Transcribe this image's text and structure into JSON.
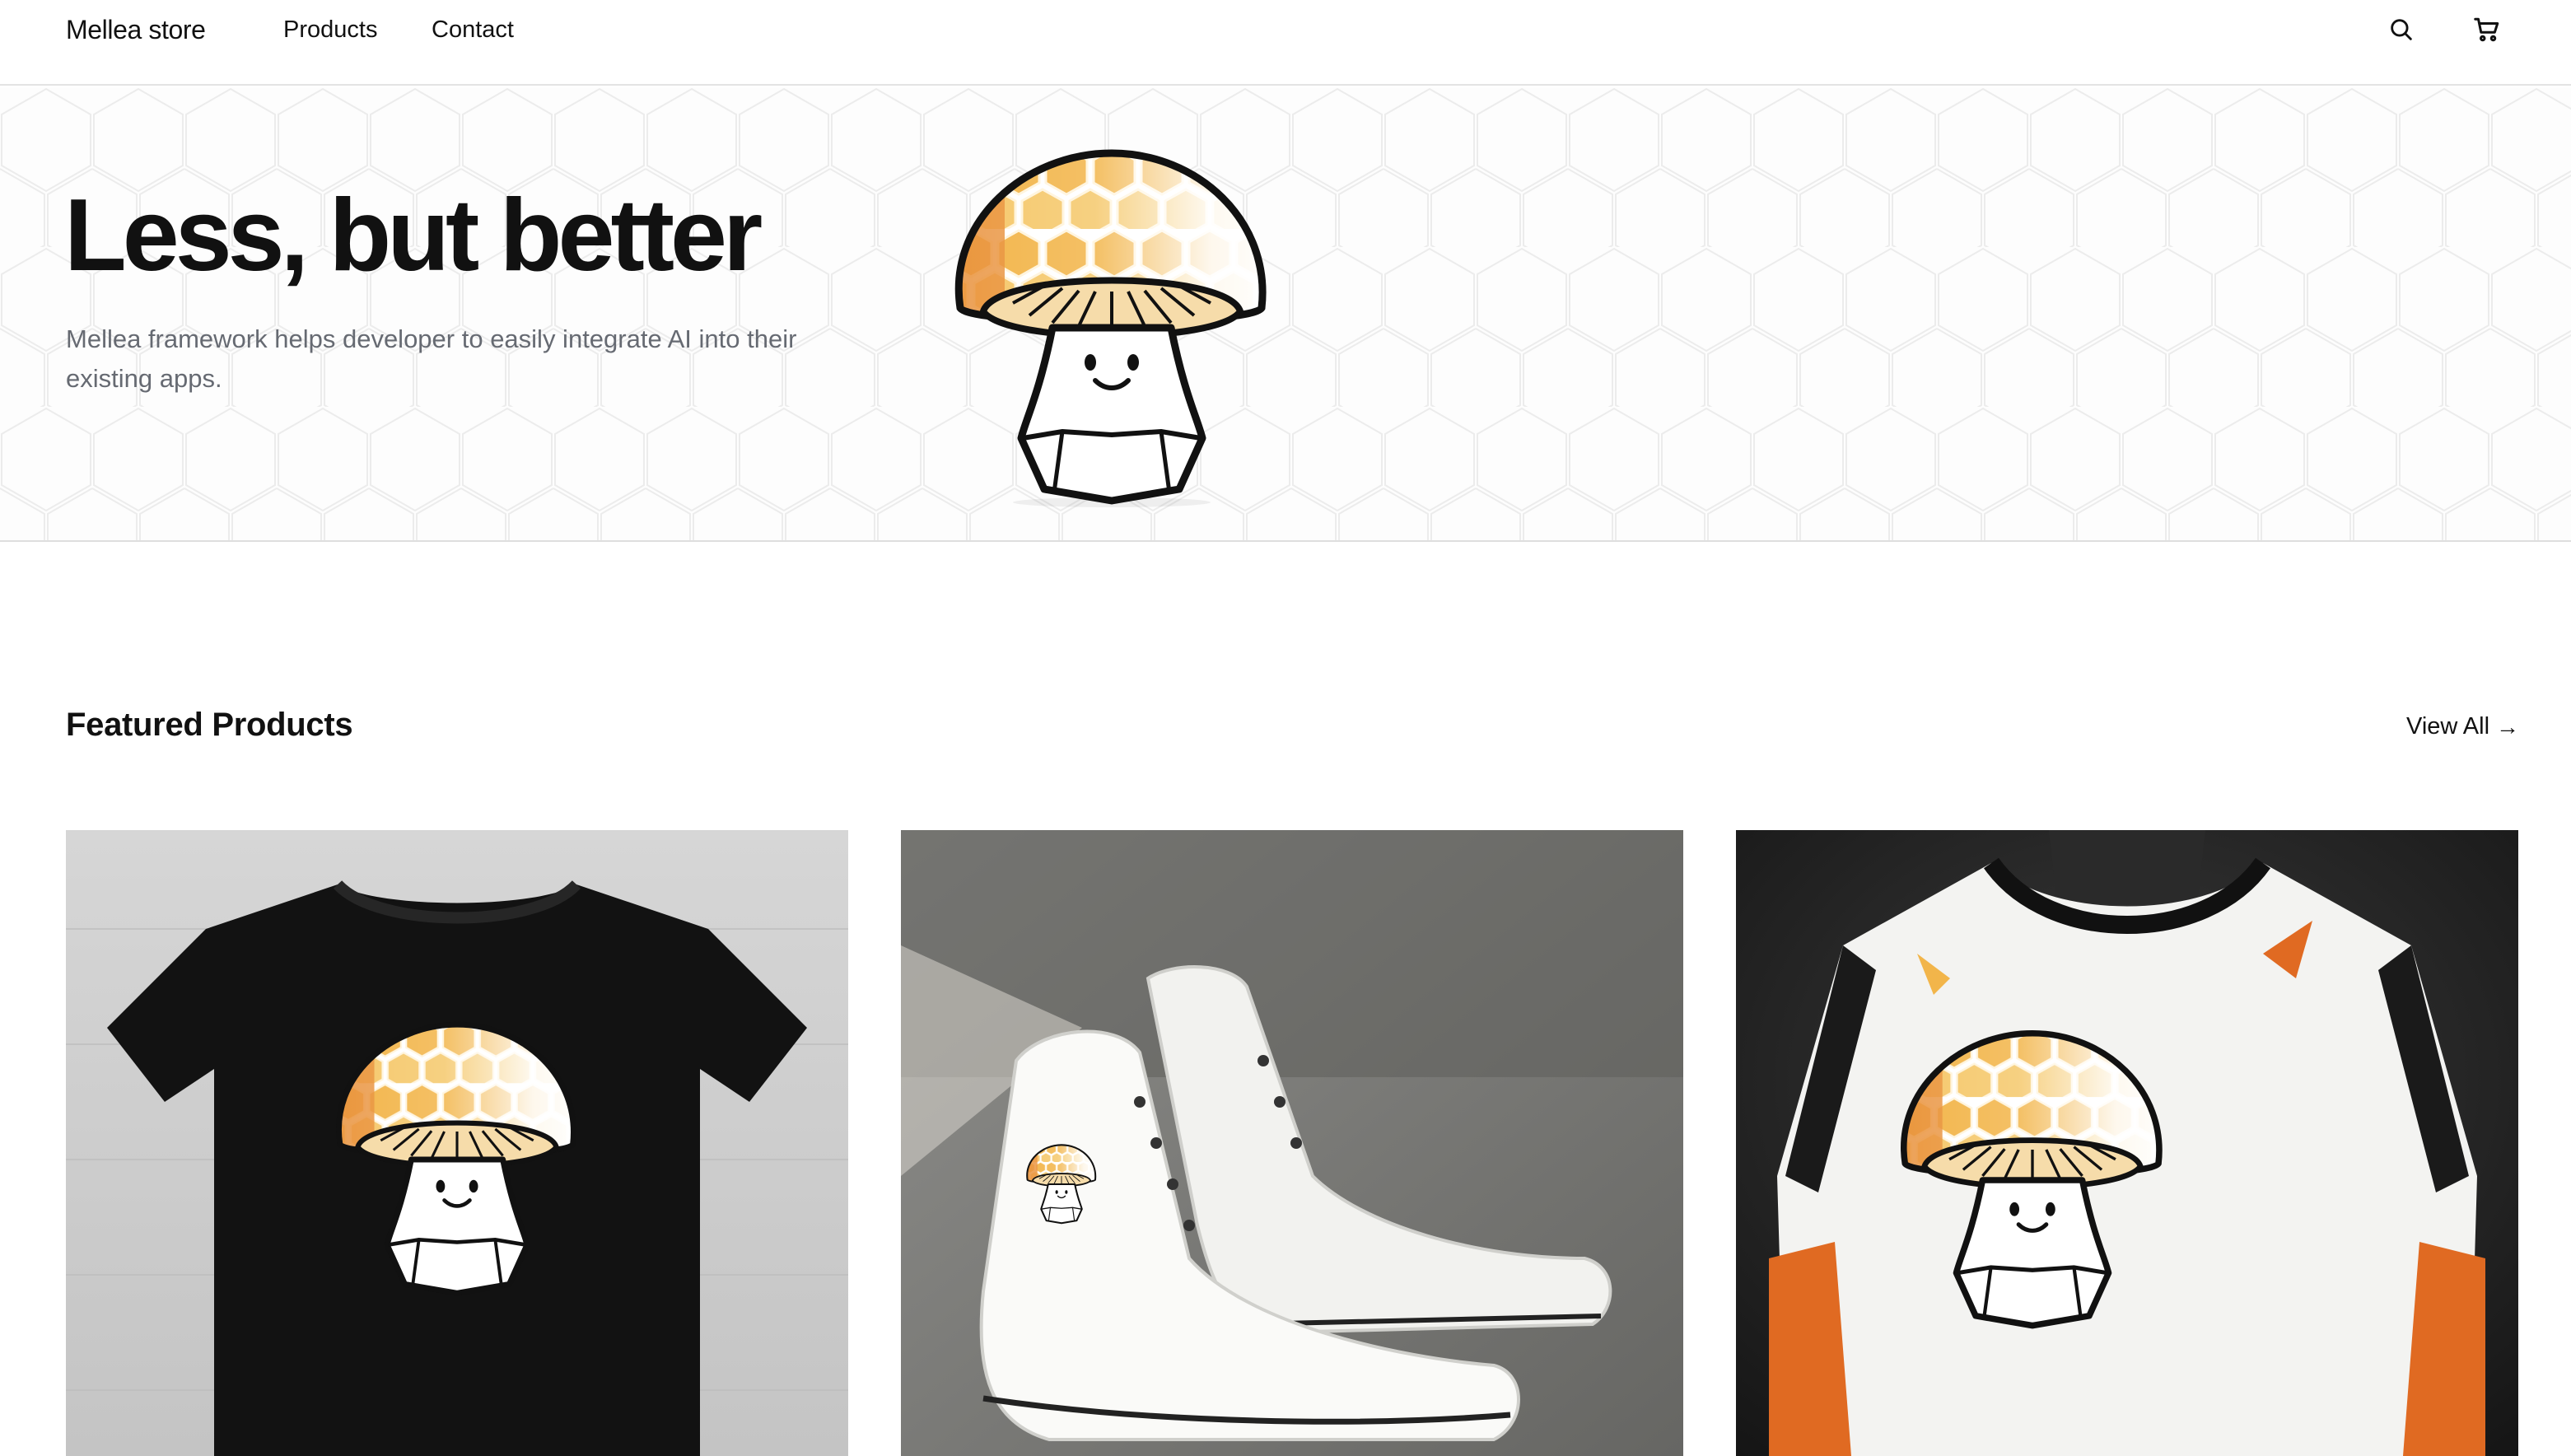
{
  "header": {
    "brand": "Mellea store",
    "nav": [
      {
        "label": "Products"
      },
      {
        "label": "Contact"
      }
    ],
    "icons": [
      "search-icon",
      "cart-icon"
    ]
  },
  "hero": {
    "title": "Less, but better",
    "subtitle": "Mellea framework helps developer to easily integrate AI into their existing apps.",
    "image": "mushroom-mascot"
  },
  "featured": {
    "title": "Featured Products",
    "view_all": "View All",
    "view_all_icon": "arrow-right-icon",
    "products": [
      {
        "image": "black-tshirt-with-mushroom-mascot"
      },
      {
        "image": "white-high-top-sneakers-with-mushroom-mascot"
      },
      {
        "image": "white-orange-jersey-with-mushroom-mascot"
      }
    ]
  },
  "colors": {
    "text": "#111111",
    "muted": "#666a72",
    "border": "#e3e3e3",
    "honey": "#f2b54a",
    "honey_light": "#f7dca2",
    "orange": "#e06a22"
  }
}
